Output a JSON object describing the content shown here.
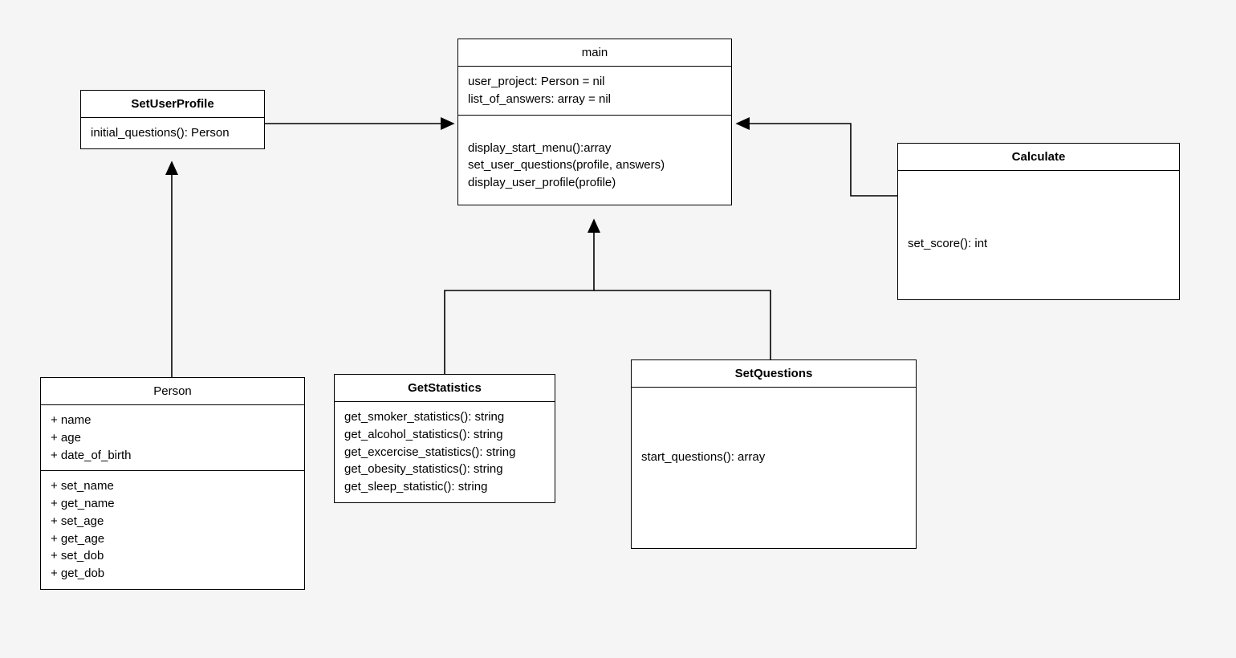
{
  "classes": {
    "set_user_profile": {
      "title": "SetUserProfile",
      "methods": [
        "initial_questions(): Person"
      ]
    },
    "main": {
      "title": "main",
      "attributes": [
        "user_project: Person = nil",
        "list_of_answers: array = nil"
      ],
      "methods": [
        "display_start_menu():array",
        "set_user_questions(profile, answers)",
        "display_user_profile(profile)"
      ]
    },
    "calculate": {
      "title": "Calculate",
      "methods": [
        "set_score(): int"
      ]
    },
    "person": {
      "title": "Person",
      "attributes": [
        "+ name",
        "+ age",
        "+ date_of_birth"
      ],
      "methods": [
        "+ set_name",
        "+ get_name",
        "+ set_age",
        "+ get_age",
        "+ set_dob",
        "+ get_dob"
      ]
    },
    "get_statistics": {
      "title": "GetStatistics",
      "methods": [
        "get_smoker_statistics(): string",
        "get_alcohol_statistics(): string",
        "get_excercise_statistics(): string",
        "get_obesity_statistics(): string",
        "get_sleep_statistic(): string"
      ]
    },
    "set_questions": {
      "title": "SetQuestions",
      "methods": [
        "start_questions(): array"
      ]
    }
  }
}
